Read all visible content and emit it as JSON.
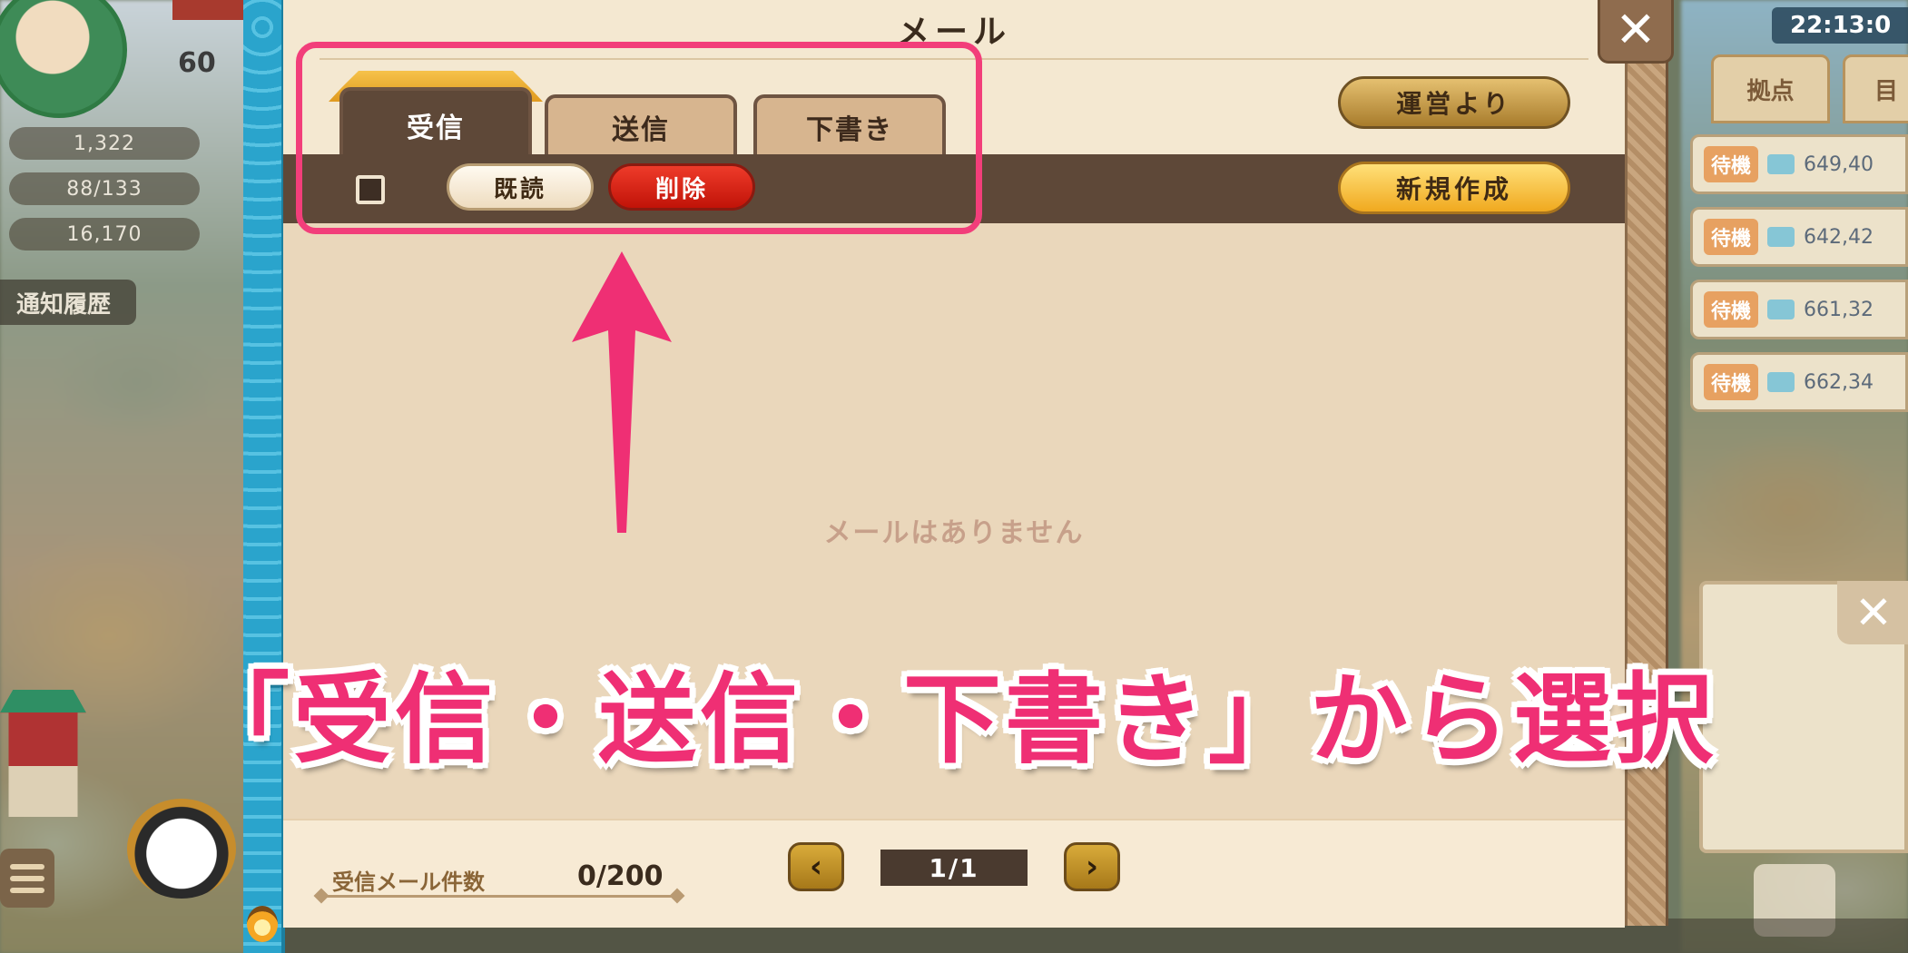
{
  "window": {
    "title": "メール",
    "close_icon": "close-icon"
  },
  "tabs": [
    {
      "label": "受信",
      "active": true
    },
    {
      "label": "送信",
      "active": false
    },
    {
      "label": "下書き",
      "active": false
    }
  ],
  "buttons": {
    "from_operator": "運営より",
    "new_compose": "新規作成",
    "mark_read": "既読",
    "delete": "削除"
  },
  "list": {
    "empty_message": "メールはありません"
  },
  "footer": {
    "count_label": "受信メール件数",
    "count_value": "0/200",
    "page_indicator": "1/1",
    "prev_icon": "chevron-left-icon",
    "next_icon": "chevron-right-icon"
  },
  "annotation": {
    "caption": "「受信・送信・下書き」から選択",
    "highlight_color": "#f23e7a",
    "arrow_icon": "arrow-up-icon"
  },
  "background_hud": {
    "top_number": "60",
    "resources": [
      "1,322",
      "88/133",
      "16,170"
    ],
    "notification_button": "通知履歴",
    "clock": "22:13:0",
    "right_tabs": [
      "拠点",
      "目"
    ],
    "right_rows": [
      {
        "tag": "待機",
        "value": "649,40"
      },
      {
        "tag": "待機",
        "value": "642,42"
      },
      {
        "tag": "待機",
        "value": "661,32"
      },
      {
        "tag": "待機",
        "value": "662,34"
      }
    ]
  },
  "colors": {
    "accent_pink": "#ef2f74",
    "delete_red": "#c11308",
    "gold": "#f0a91f",
    "panel_brown": "#5e4838",
    "frame_blue": "#2aa4cc"
  }
}
